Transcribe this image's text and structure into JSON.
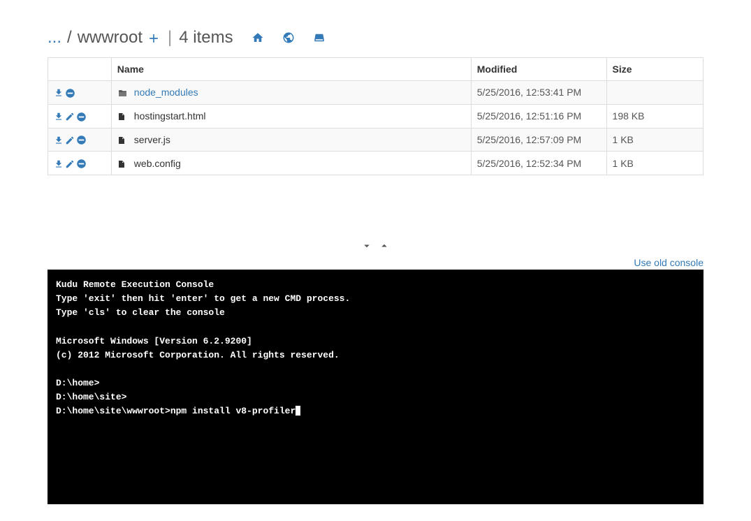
{
  "breadcrumb": {
    "ellipsis": "...",
    "sep1": "/",
    "current": "wwwroot",
    "count_label": "4 items"
  },
  "table": {
    "headers": {
      "name": "Name",
      "modified": "Modified",
      "size": "Size"
    },
    "rows": [
      {
        "type": "folder",
        "name": "node_modules",
        "modified": "5/25/2016, 12:53:41 PM",
        "size": "",
        "editable": false
      },
      {
        "type": "file",
        "name": "hostingstart.html",
        "modified": "5/25/2016, 12:51:16 PM",
        "size": "198 KB",
        "editable": true
      },
      {
        "type": "file",
        "name": "server.js",
        "modified": "5/25/2016, 12:57:09 PM",
        "size": "1 KB",
        "editable": true
      },
      {
        "type": "file",
        "name": "web.config",
        "modified": "5/25/2016, 12:52:34 PM",
        "size": "1 KB",
        "editable": true
      }
    ]
  },
  "old_console_link": "Use old console",
  "console": {
    "lines": [
      "Kudu Remote Execution Console",
      "Type 'exit' then hit 'enter' to get a new CMD process.",
      "Type 'cls' to clear the console",
      "",
      "Microsoft Windows [Version 6.2.9200]",
      "(c) 2012 Microsoft Corporation. All rights reserved.",
      "",
      "D:\\home>",
      "D:\\home\\site>"
    ],
    "prompt": "D:\\home\\site\\wwwroot>",
    "input": "npm install v8-profiler"
  }
}
